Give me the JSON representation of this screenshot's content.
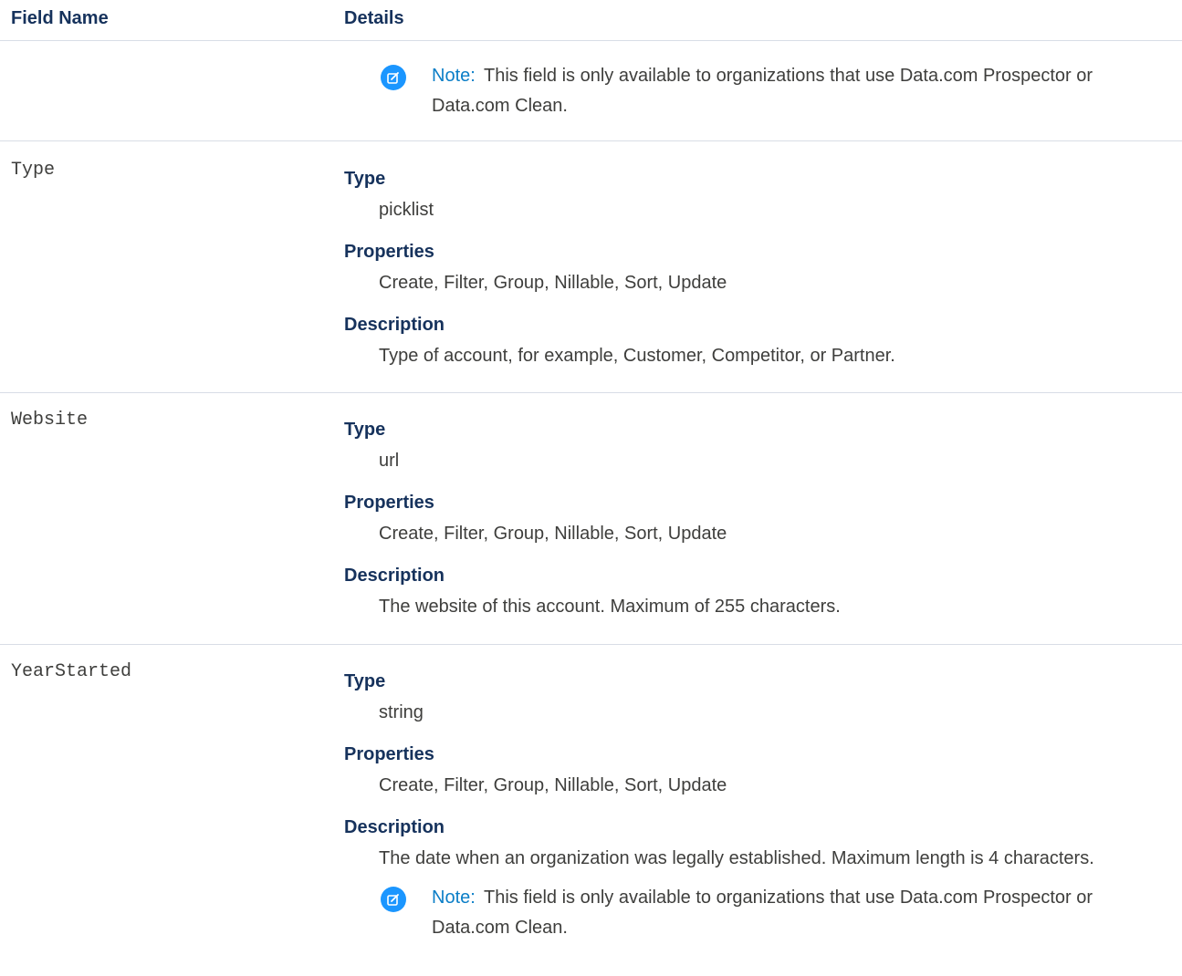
{
  "header": {
    "field_name": "Field Name",
    "details": "Details"
  },
  "note_top": {
    "label": "Note:",
    "text": "This field is only available to organizations that use Data.com Prospector or Data.com Clean."
  },
  "fields": [
    {
      "name": "Type",
      "type_label": "Type",
      "type": "picklist",
      "properties_label": "Properties",
      "properties": "Create, Filter, Group, Nillable, Sort, Update",
      "description_label": "Description",
      "description": "Type of account, for example, Customer, Competitor, or Partner."
    },
    {
      "name": "Website",
      "type_label": "Type",
      "type": "url",
      "properties_label": "Properties",
      "properties": "Create, Filter, Group, Nillable, Sort, Update",
      "description_label": "Description",
      "description": "The website of this account. Maximum of 255 characters."
    },
    {
      "name": "YearStarted",
      "type_label": "Type",
      "type": "string",
      "properties_label": "Properties",
      "properties": "Create, Filter, Group, Nillable, Sort, Update",
      "description_label": "Description",
      "description": "The date when an organization was legally established. Maximum length is 4 characters.",
      "note_label": "Note:",
      "note_text": "This field is only available to organizations that use Data.com Prospector or Data.com Clean."
    }
  ],
  "icons": {
    "note": "edit-note-icon"
  },
  "colors": {
    "heading": "#16325c",
    "note_icon": "#1b96ff",
    "note_label": "#0b7ec7",
    "divider": "#d8dde6"
  }
}
